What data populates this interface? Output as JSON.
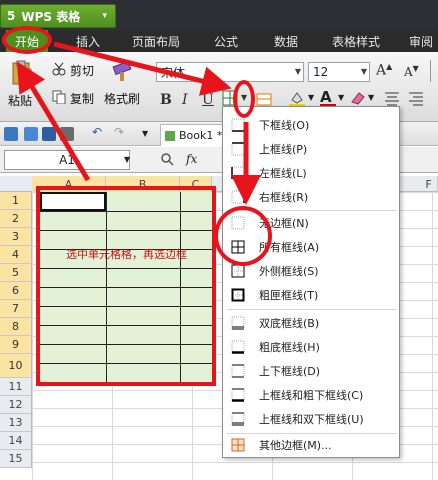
{
  "app": {
    "logo": "5",
    "name": "WPS 表格",
    "menu_arrow": "▾"
  },
  "tabs": [
    "开始",
    "插入",
    "页面布局",
    "公式",
    "数据",
    "表格样式",
    "审阅"
  ],
  "ribbon": {
    "paste": "粘贴",
    "cut": "剪切",
    "copy": "复制",
    "format_painter": "格式刷",
    "font_name": "宋体",
    "font_size": "12",
    "bold": "B",
    "italic": "I",
    "underline": "U"
  },
  "toolbar2": {
    "book_tab": "Book1 *"
  },
  "formula_bar": {
    "name_box": "A1",
    "fx": "fx"
  },
  "sheet": {
    "columns": [
      "A",
      "B",
      "C",
      "F"
    ],
    "rows": [
      "1",
      "2",
      "3",
      "4",
      "5",
      "6",
      "7",
      "8",
      "9",
      "10",
      "11",
      "12",
      "13",
      "14",
      "15"
    ],
    "selected_rows": 10,
    "instruction": "选中单元格格，再选边框"
  },
  "border_menu": {
    "items": [
      {
        "label": "下框线(O)",
        "icon": "bottom-border-icon"
      },
      {
        "label": "上框线(P)",
        "icon": "top-border-icon"
      },
      {
        "label": "左框线(L)",
        "icon": "left-border-icon"
      },
      {
        "label": "右框线(R)",
        "icon": "right-border-icon"
      },
      {
        "label": "无边框(N)",
        "icon": "no-border-icon"
      },
      {
        "label": "所有框线(A)",
        "icon": "all-borders-icon"
      },
      {
        "label": "外侧框线(S)",
        "icon": "outside-borders-icon"
      },
      {
        "label": "粗匣框线(T)",
        "icon": "thick-box-border-icon"
      },
      {
        "label": "双底框线(B)",
        "icon": "double-bottom-border-icon"
      },
      {
        "label": "粗底框线(H)",
        "icon": "thick-bottom-border-icon"
      },
      {
        "label": "上下框线(D)",
        "icon": "top-bottom-border-icon"
      },
      {
        "label": "上框线和粗下框线(C)",
        "icon": "top-thick-bottom-border-icon"
      },
      {
        "label": "上框线和双下框线(U)",
        "icon": "top-double-bottom-border-icon"
      },
      {
        "label": "其他边框(M)...",
        "icon": "more-borders-icon"
      }
    ]
  },
  "colors": {
    "accent_green": "#4d8e1e",
    "annotation_red": "#e8141c",
    "selection_fill": "#e3f2d6",
    "instruction_red": "#c41313"
  }
}
